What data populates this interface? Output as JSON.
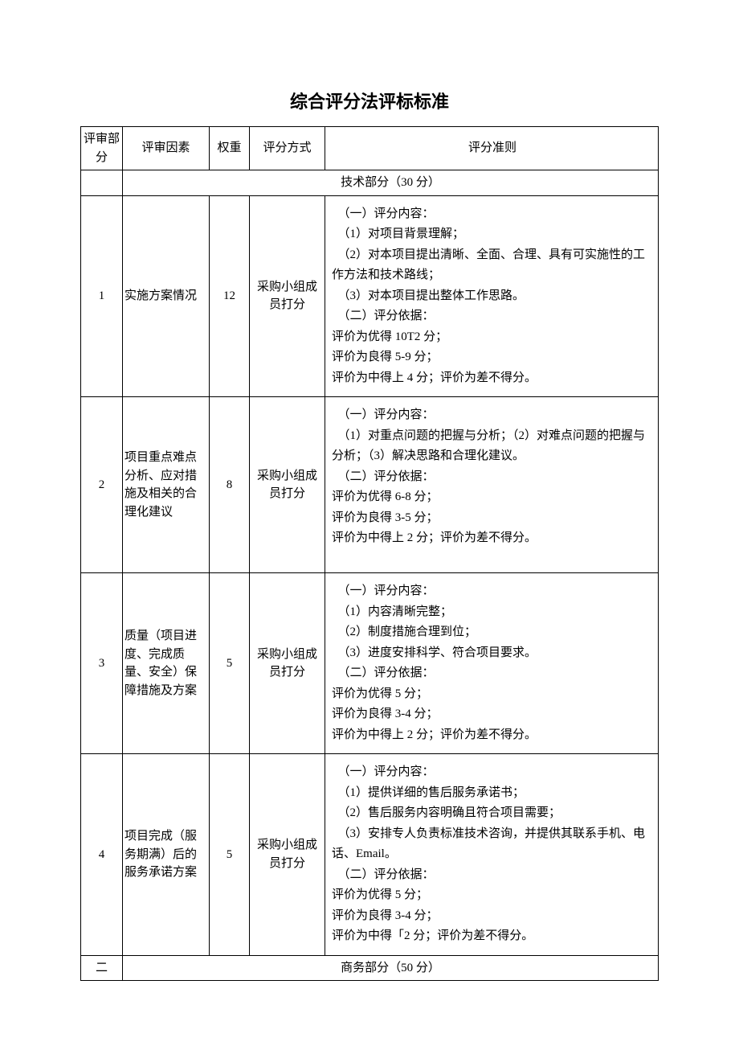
{
  "title": "综合评分法评标标准",
  "headers": {
    "part": "评审部分",
    "factor": "评审因素",
    "weight": "权重",
    "method": "评分方式",
    "criteria": "评分准则"
  },
  "section1": {
    "num": "",
    "label": "技术部分（30 分）"
  },
  "rows": [
    {
      "num": "1",
      "factor": "实施方案情况",
      "weight": "12",
      "method": "采购小组成员打分",
      "criteria": "　（一）评分内容：\n　（1）对项目背景理解；\n　（2）对本项目提出清晰、全面、合理、具有可实施性的工作方法和技术路线；\n　（3）对本项目提出整体工作思路。\n　（二）评分依据：\n评价为优得 10T2 分；\n评价为良得 5-9 分；\n评价为中得上 4 分；评价为差不得分。"
    },
    {
      "num": "2",
      "factor": "项目重点难点分析、应对措施及相关的合理化建议",
      "weight": "8",
      "method": "采购小组成员打分",
      "criteria": "　（一）评分内容：\n　（1）对重点问题的把握与分析；（2）对难点问题的把握与分析；（3）解决思路和合理化建议。\n　（二）评分依据：\n评价为优得 6-8 分；\n评价为良得 3-5 分；\n评价为中得上 2 分；评价为差不得分。"
    },
    {
      "num": "3",
      "factor": "质量（项目进度、完成质量、安全）保障措施及方案",
      "weight": "5",
      "method": "采购小组成员打分",
      "criteria": "　（一）评分内容：\n　（1）内容清晰完整；\n　（2）制度措施合理到位；\n　（3）进度安排科学、符合项目要求。\n　（二）评分依据：\n评价为优得 5 分；\n评价为良得 3-4 分；\n评价为中得上 2 分；评价为差不得分。"
    },
    {
      "num": "4",
      "factor": "项目完成（服务期满）后的服务承诺方案",
      "weight": "5",
      "method": "采购小组成员打分",
      "criteria": "　（一）评分内容：\n　（1）提供详细的售后服务承诺书；\n　（2）售后服务内容明确且符合项目需要；\n　（3）安排专人负责标准技术咨询，并提供其联系手机、电话、Email。\n　（二）评分依据：\n评价为优得 5 分；\n评价为良得 3-4 分；\n评价为中得「2 分；评价为差不得分。"
    }
  ],
  "section2": {
    "num": "二",
    "label": "商务部分（50 分）"
  }
}
